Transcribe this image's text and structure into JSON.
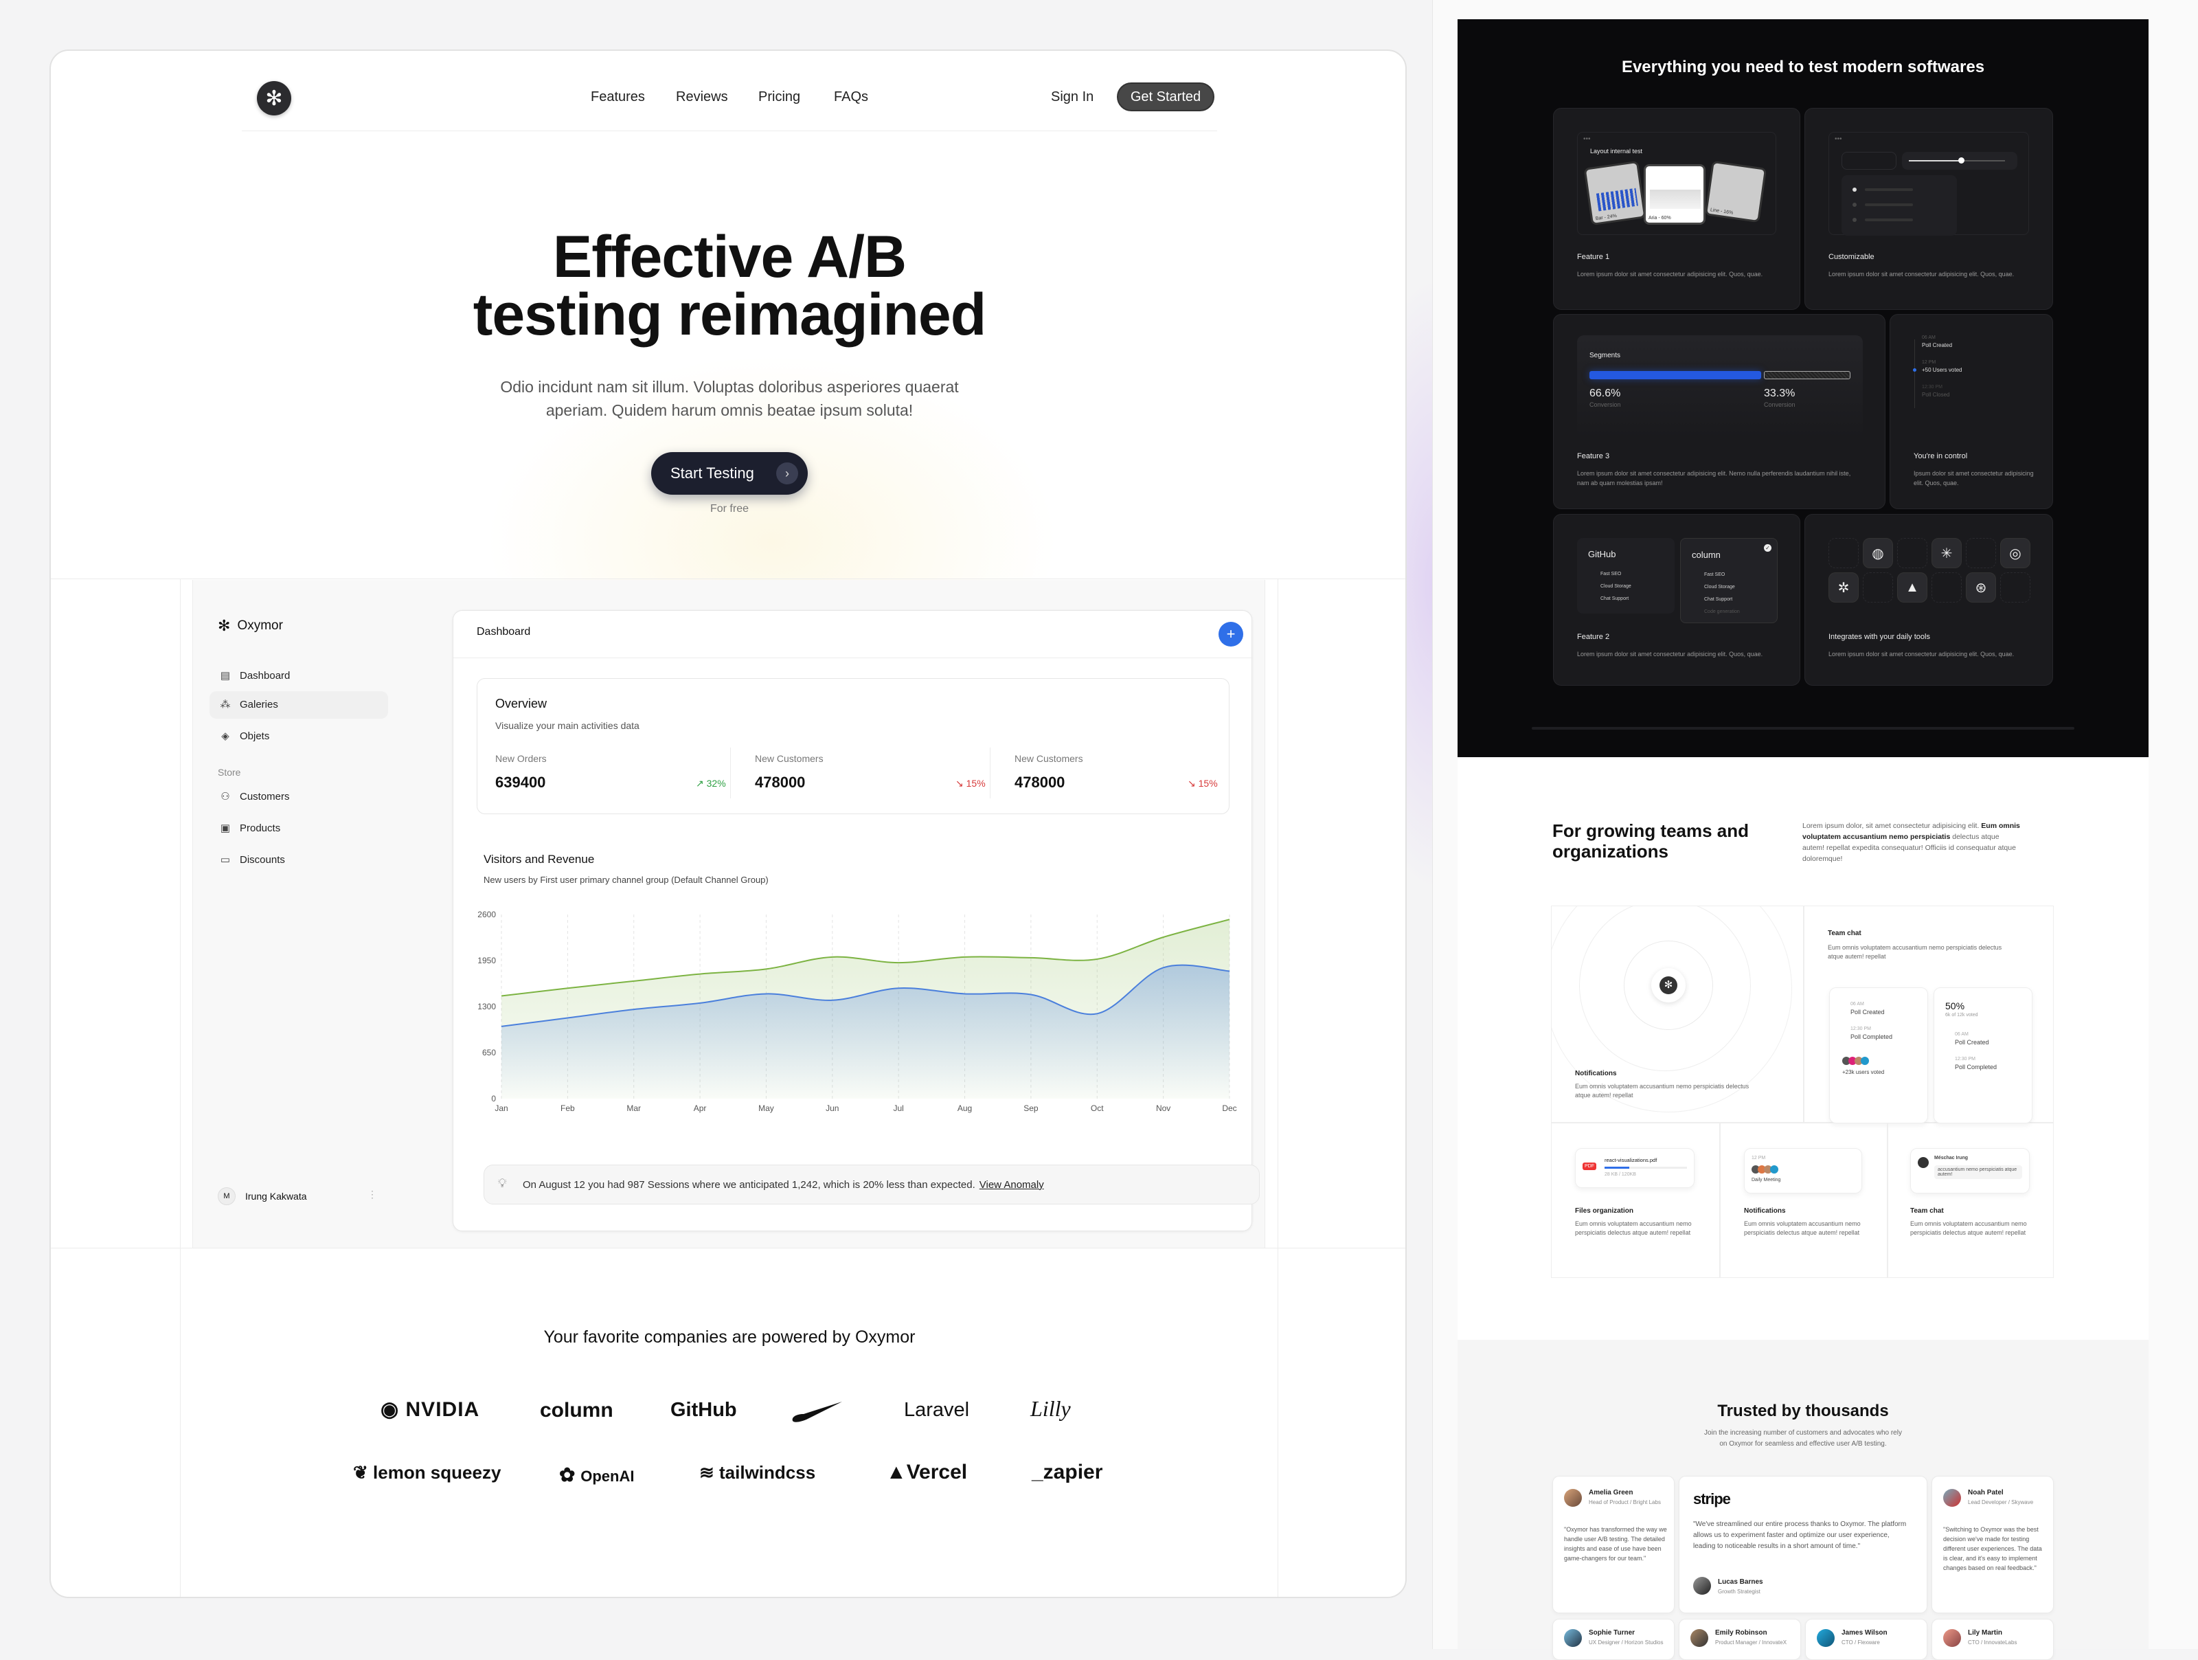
{
  "nav": {
    "links": [
      "Features",
      "Reviews",
      "Pricing",
      "FAQs"
    ],
    "sign_in": "Sign In",
    "get_started": "Get Started"
  },
  "hero": {
    "title_line1": "Effective A/B",
    "title_line2": "testing reimagined",
    "subtitle_line1": "Odio incidunt nam sit illum. Voluptas doloribus asperiores quaerat",
    "subtitle_line2": "aperiam. Quidem harum omnis beatae ipsum soluta!",
    "cta": "Start Testing",
    "cta_note": "For free"
  },
  "dashboard": {
    "brand": "Oxymor",
    "sidebar": [
      {
        "label": "Dashboard",
        "icon": "layout-icon"
      },
      {
        "label": "Galeries",
        "icon": "shapes-icon",
        "active": true
      },
      {
        "label": "Objets",
        "icon": "tag-icon"
      }
    ],
    "store_heading": "Store",
    "store_items": [
      {
        "label": "Customers",
        "icon": "users-icon"
      },
      {
        "label": "Products",
        "icon": "box-icon"
      },
      {
        "label": "Discounts",
        "icon": "ticket-icon"
      }
    ],
    "user": {
      "initial": "M",
      "name": "Irung Kakwata"
    },
    "header_title": "Dashboard",
    "overview": {
      "title": "Overview",
      "subtitle": "Visualize your main activities data",
      "stats": [
        {
          "label": "New Orders",
          "value": "639400",
          "delta": "32%",
          "trend": "up"
        },
        {
          "label": "New Customers",
          "value": "478000",
          "delta": "15%",
          "trend": "down"
        },
        {
          "label": "New Customers",
          "value": "478000",
          "delta": "15%",
          "trend": "down"
        }
      ]
    },
    "chart_title": "Visitors and Revenue",
    "chart_subtitle": "New users by First user primary channel group (Default Channel Group)",
    "insight": "On August 12 you had 987 Sessions where we anticipated 1,242, which is 20% less than expected.",
    "insight_link": "View Anomaly"
  },
  "chart_data": {
    "type": "area",
    "categories": [
      "Jan",
      "Feb",
      "Mar",
      "Apr",
      "May",
      "Jun",
      "Jul",
      "Aug",
      "Sep",
      "Oct",
      "Nov",
      "Dec"
    ],
    "yticks": [
      "0",
      "650",
      "1300",
      "1950",
      "2600"
    ],
    "ylim": [
      0,
      2600
    ],
    "grid": "vertical dashed",
    "series": [
      {
        "color": "#7cb342",
        "values": [
          1450,
          1560,
          1660,
          1760,
          1830,
          2000,
          1920,
          2000,
          1990,
          1970,
          2280,
          2530
        ]
      },
      {
        "color": "#4a7fdc",
        "values": [
          1020,
          1140,
          1260,
          1350,
          1480,
          1390,
          1560,
          1480,
          1470,
          1200,
          1850,
          1800
        ]
      }
    ]
  },
  "companies": {
    "title": "Your favorite companies are powered by Oxymor",
    "row1": [
      "NVIDIA",
      "column",
      "GitHub",
      "Nike",
      "Laravel",
      "Lilly"
    ],
    "row2": [
      "lemon squeezy",
      "OpenAI",
      "tailwindcss",
      "Vercel",
      "_zapier"
    ]
  },
  "features": {
    "title": "Everything you need to test modern softwares",
    "cards": [
      {
        "title": "Feature 1",
        "desc": "Lorem ipsum dolor sit amet consectetur adipisicing elit. Quos, quae.",
        "mock_title": "Layout internal test",
        "mock_labels": [
          "Bar - 24%",
          "Aria - 60%",
          "Line - 16%"
        ]
      },
      {
        "title": "Customizable",
        "desc": "Lorem ipsum dolor sit amet consectetur adipisicing elit. Quos, quae."
      },
      {
        "title": "Feature 3",
        "desc": "Lorem ipsum dolor sit amet consectetur adipisicing elit. Nemo nulla perferendis laudantium nihil iste, nam ab quam molestias ipsam!",
        "mock_title": "Segments",
        "segments": [
          {
            "value": "66.6%",
            "label": "Conversion",
            "fraction": 0.666
          },
          {
            "value": "33.3%",
            "label": "Conversion",
            "fraction": 0.333
          }
        ]
      },
      {
        "title": "You're in control",
        "desc": "Ipsum dolor sit amet consectetur adipisicing elit. Quos, quae.",
        "timeline": [
          {
            "time": "06 AM",
            "text": "Poll Created"
          },
          {
            "time": "12 PM",
            "text": "+50 Users voted"
          },
          {
            "time": "12:30 PM",
            "text": "Poll Closed"
          }
        ]
      },
      {
        "title": "Feature 2",
        "desc": "Lorem ipsum dolor sit amet consectetur adipisicing elit. Quos, quae.",
        "plans": [
          {
            "name": "GitHub",
            "items": [
              "Fast SEO",
              "Cloud Storage",
              "Chat Support"
            ]
          },
          {
            "name": "column",
            "items": [
              "Fast SEO",
              "Cloud Storage",
              "Chat Support",
              "Code generation"
            ]
          }
        ]
      },
      {
        "title": "Integrates with your daily tools",
        "desc": "Lorem ipsum dolor sit amet consectetur adipisicing elit. Quos, quae."
      }
    ]
  },
  "teams": {
    "title": "For growing teams and organizations",
    "para_1": "Lorem ipsum dolor, sit amet consectetur adipisicing elit.",
    "para_bold": "Eum omnis voluptatem accusantium nemo perspiciatis",
    "para_2": "delectus atque autem! repellat expedita consequatur! Officiis id consequatur atque doloremque!",
    "cells": [
      {
        "title": "Notifications",
        "desc": "Eum omnis voluptatem accusantium nemo perspiciatis delectus atque autem! repellat"
      },
      {
        "title": "Team chat",
        "desc": "Eum omnis voluptatem accusantium nemo perspiciatis delectus atque autem! repellat"
      },
      {
        "title": "Files organization",
        "desc": "Eum omnis voluptatem accusantium nemo perspiciatis delectus atque autem! repellat"
      },
      {
        "title": "Notifications",
        "desc": "Eum omnis voluptatem accusantium nemo perspiciatis delectus atque autem! repellat"
      },
      {
        "title": "Team chat",
        "desc": "Eum omnis voluptatem accusantium nemo perspiciatis delectus atque autem! repellat"
      }
    ],
    "poll1": {
      "t1": "06 AM",
      "e1": "Poll Created",
      "t2": "12:30 PM",
      "e2": "Poll Completed",
      "voted": "+23k users voted"
    },
    "poll2": {
      "pct": "50%",
      "sub": "6k of 12k voted",
      "t1": "06 AM",
      "e1": "Poll Created",
      "t2": "12:30 PM",
      "e2": "Poll Completed"
    },
    "file": {
      "name": "react-visualizations.pdf",
      "size": "28 KB / 120KB",
      "badge": "PDF",
      "progress": 0.3
    },
    "meeting": {
      "time": "12 PM",
      "label": "Daily Meeting"
    },
    "chat": {
      "name": "Méschac Irung",
      "msg": "accusantium nemo perspiciatis atque autem!"
    }
  },
  "testimonials": {
    "title": "Trusted by thousands",
    "subtitle_line1": "Join the increasing number of customers and advocates who rely",
    "subtitle_line2": "on Oxymor for seamless and effective user A/B testing.",
    "featured": {
      "logo": "stripe",
      "quote": "\"We've streamlined our entire process thanks to Oxymor. The platform allows us to experiment faster and optimize our user experience, leading to noticeable results in a short amount of time.\"",
      "name": "Lucas Barnes",
      "role": "Growth Strategist"
    },
    "cards": [
      {
        "name": "Amelia Green",
        "role": "Head of Product / Bright Labs",
        "quote": "\"Oxymor has transformed the way we handle user A/B testing. The detailed insights and ease of use have been game-changers for our team.\""
      },
      {
        "name": "Noah Patel",
        "role": "Lead Developer / Skywave",
        "quote": "\"Switching to Oxymor was the best decision we've made for testing different user experiences. The data is clear, and it's easy to implement changes based on real feedback.\""
      }
    ],
    "row2": [
      {
        "name": "Sophie Turner",
        "role": "UX Designer / Horizon Studios"
      },
      {
        "name": "Emily Robinson",
        "role": "Product Manager / InnovateX"
      },
      {
        "name": "James Wilson",
        "role": "CTO / Flexware"
      },
      {
        "name": "Lily Martin",
        "role": "CTO / InnovateLabs"
      }
    ]
  }
}
